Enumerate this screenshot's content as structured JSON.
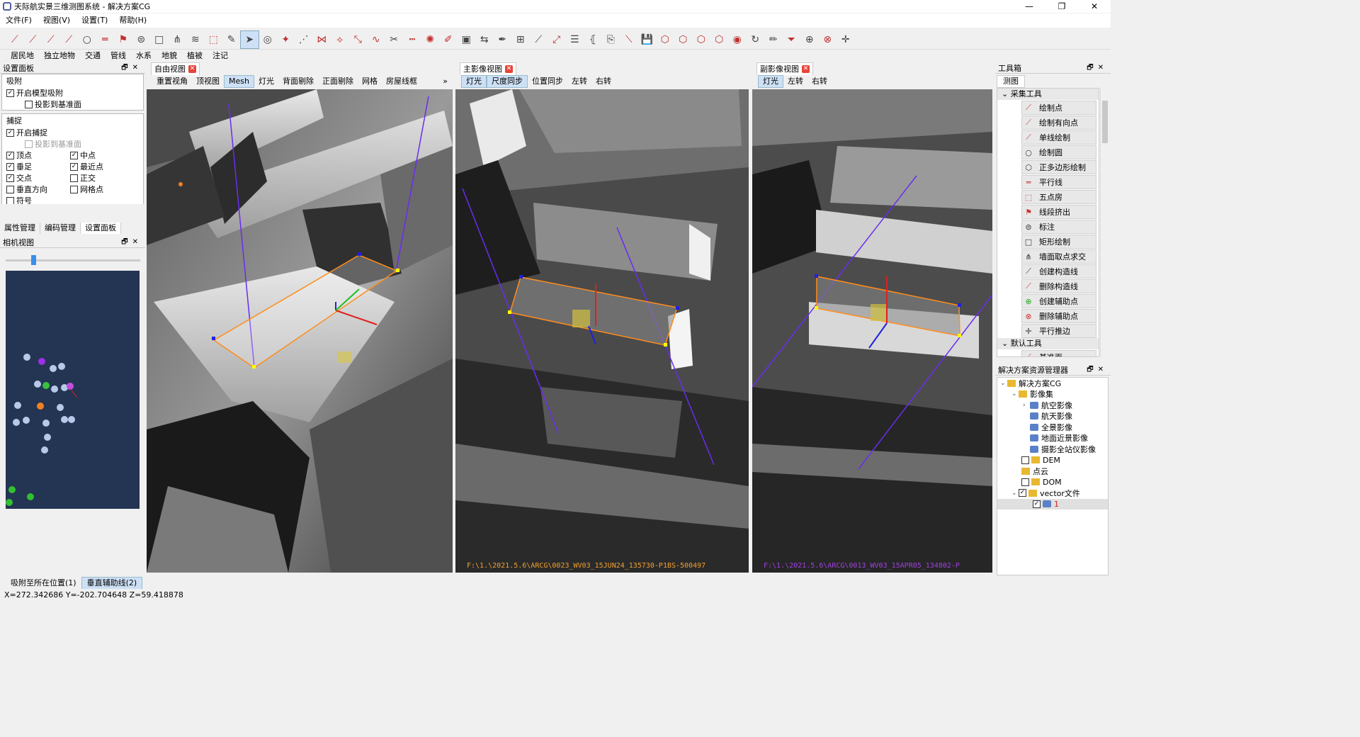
{
  "window": {
    "title": "天际航实景三维测图系统 - 解决方案CG",
    "controls": [
      "—",
      "❐",
      "✕"
    ]
  },
  "menu": [
    "文件(F)",
    "视图(V)",
    "设置(T)",
    "帮助(H)"
  ],
  "layers": [
    "居民地",
    "独立地物",
    "交通",
    "管线",
    "水系",
    "地貌",
    "植被",
    "注记"
  ],
  "settings": {
    "title": "设置面板",
    "snap_group": {
      "title": "吸附",
      "enable": "开启模型吸附",
      "project": "投影到基准面"
    },
    "capture_group": {
      "title": "捕捉",
      "enable": "开启捕捉",
      "project": "投影到基准面",
      "options": [
        "顶点",
        "中点",
        "垂足",
        "最近点",
        "交点",
        "正交",
        "垂直方向",
        "网格点",
        "符号"
      ]
    },
    "tabs": [
      "属性管理",
      "编码管理",
      "设置面板"
    ]
  },
  "camera": {
    "title": "相机视图"
  },
  "free_view": {
    "tab": "自由视图",
    "tools": [
      "重置视角",
      "顶视图",
      "Mesh",
      "灯光",
      "背面剔除",
      "正面剔除",
      "网格",
      "房屋线框"
    ],
    "more": "»"
  },
  "main_view": {
    "tab": "主影像视图",
    "tools": [
      "灯光",
      "尺度同步",
      "位置同步",
      "左转",
      "右转"
    ],
    "path": "F:\\1.\\2021.5.6\\ARCG\\0023_WV03_15JUN24_135730-P1BS-500497"
  },
  "sub_view": {
    "tab": "副影像视图",
    "tools": [
      "灯光",
      "左转",
      "右转"
    ],
    "path": "F:\\1.\\2021.5.6\\ARCG\\0013_WV03_15APR05_134802-P"
  },
  "toolbox": {
    "title": "工具箱",
    "tab": "测图",
    "section1": "采集工具",
    "items": [
      "绘制点",
      "绘制有向点",
      "单线绘制",
      "绘制圆",
      "正多边形绘制",
      "平行线",
      "五点房",
      "线段挤出",
      "标注",
      "矩形绘制",
      "墙面取点求交",
      "创建构造线",
      "删除构造线",
      "创建辅助点",
      "删除辅助点",
      "平行推边"
    ],
    "section2": "默认工具",
    "partial": "基准面"
  },
  "solution": {
    "title": "解决方案资源管理器",
    "root": "解决方案CG",
    "imageset": "影像集",
    "images": [
      "航空影像",
      "航天影像",
      "全景影像",
      "地面近景影像",
      "摄影全站仪影像"
    ],
    "dem": "DEM",
    "pointcloud": "点云",
    "dom": "DOM",
    "vector": "vector文件",
    "vector_child": "1"
  },
  "bottom_tabs": [
    "吸附至所在位置(1)",
    "垂直辅助线(2)"
  ],
  "status": "X=272.342686  Y=-202.704648  Z=59.418878",
  "colors": {
    "accent": "#3a8ee6",
    "camera_bg": "#243453",
    "outline": "#ff8c1a",
    "guide": "#6a2cf0"
  }
}
